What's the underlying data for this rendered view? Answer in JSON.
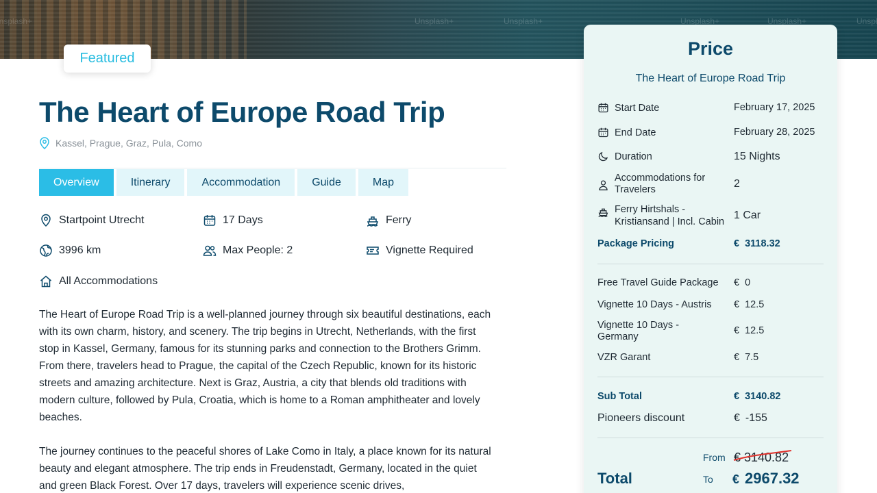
{
  "hero": {
    "watermarks": [
      "Unsplash+",
      "Unsplash+",
      "Unsplash+",
      "Unsplash+",
      "Unsplash+",
      "Unsplash+"
    ]
  },
  "badge": {
    "label": "Featured"
  },
  "trip": {
    "title": "The Heart of Europe Road Trip",
    "location": "Kassel, Prague, Graz, Pula, Como"
  },
  "tabs": [
    {
      "label": "Overview",
      "active": true
    },
    {
      "label": "Itinerary",
      "active": false
    },
    {
      "label": "Accommodation",
      "active": false
    },
    {
      "label": "Guide",
      "active": false
    },
    {
      "label": "Map",
      "active": false
    }
  ],
  "facts": {
    "startpoint": "Startpoint Utrecht",
    "days": "17 Days",
    "transport": "Ferry",
    "distance": "3996 km",
    "max_people": "Max People: 2",
    "vignette": "Vignette Required",
    "accommodations": "All Accommodations"
  },
  "description": [
    "The Heart of Europe Road Trip is a well-planned journey through six beautiful destinations, each with its own charm, history, and scenery. The trip begins in Utrecht, Netherlands, with the first stop in Kassel, Germany, famous for its stunning parks and connection to the Brothers Grimm. From there, travelers head to Prague, the capital of the Czech Republic, known for its historic streets and amazing architecture. Next is Graz, Austria, a city that blends old traditions with modern culture, followed by Pula, Croatia, which is home to a Roman amphitheater and lovely beaches.",
    "The journey continues to the peaceful shores of Lake Como in Italy, a place known for its natural beauty and elegant atmosphere. The trip ends in Freudenstadt, Germany, located in the quiet and green Black Forest. Over 17 days, travelers will experience scenic drives,"
  ],
  "price": {
    "title": "Price",
    "subtitle": "The Heart of Europe Road Trip",
    "currency": "€",
    "start_label": "Start Date",
    "start_value": "February 17, 2025",
    "end_label": "End Date",
    "end_value": "February 28, 2025",
    "duration_label": "Duration",
    "duration_value": "15 Nights",
    "travelers_label_1": "Accommodations for",
    "travelers_label_2": "Travelers",
    "travelers_value": "2",
    "ferry_label_1": "Ferry Hirtshals -",
    "ferry_label_2": "Kristiansand | Incl. Cabin",
    "ferry_value": "1 Car",
    "package_label": "Package Pricing",
    "package_value": "3118.32",
    "extras": [
      {
        "label": "Free Travel Guide Package",
        "value": "0"
      },
      {
        "label": "Vignette 10 Days - Austris",
        "value": "12.5"
      },
      {
        "label_1": "Vignette 10 Days -",
        "label_2": "Germany",
        "value": "12.5"
      },
      {
        "label": "VZR Garant",
        "value": "7.5"
      }
    ],
    "subtotal_label": "Sub Total",
    "subtotal_value": "3140.82",
    "discount_label": "Pioneers discount",
    "discount_value": "-155",
    "total_label": "Total",
    "from_label": "From",
    "to_label": "To",
    "old_total": "€ 3140.82",
    "new_total": "2967.32"
  },
  "colors": {
    "brand_dark": "#0d4a6b",
    "accent": "#2bbde6",
    "panel_bg": "#eaf6f4",
    "strike": "#e0302a"
  }
}
